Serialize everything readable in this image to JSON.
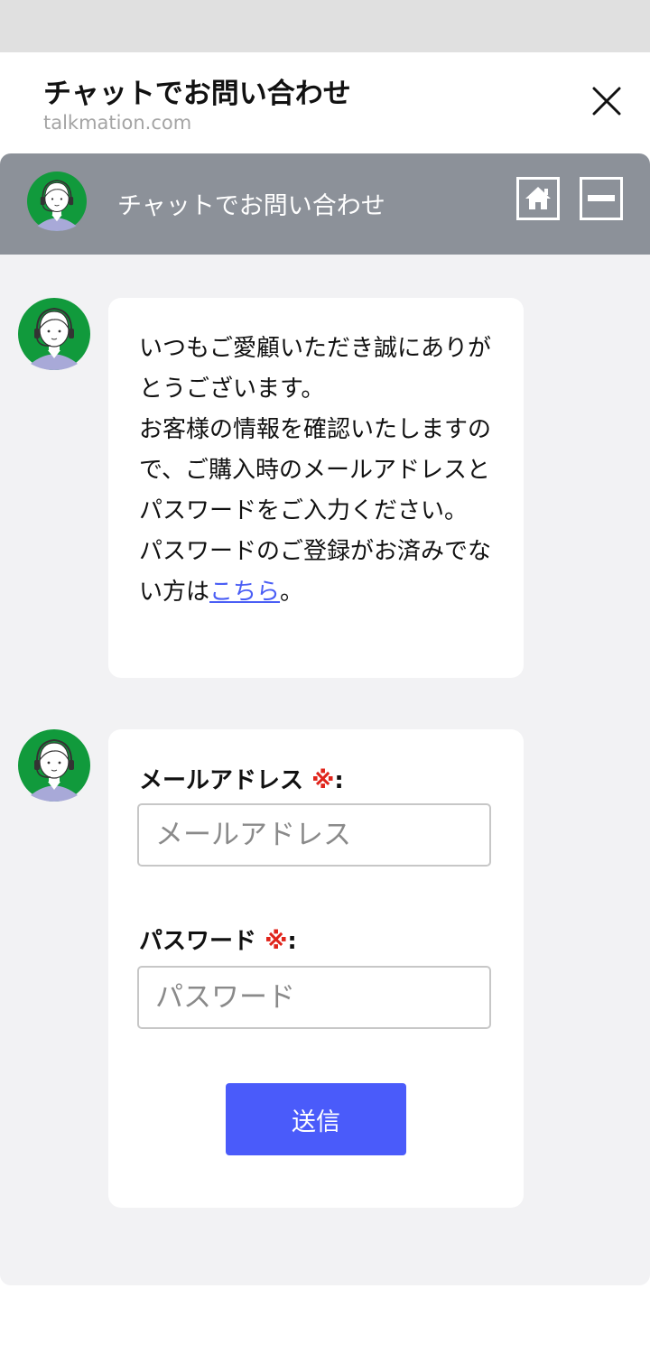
{
  "sheet": {
    "title": "チャットでお問い合わせ",
    "url": "talkmation.com"
  },
  "chat_header": {
    "title": "チャットでお問い合わせ"
  },
  "messages": {
    "welcome": {
      "text_before_link": "いつもご愛顧いただき誠にありがとうございます。\nお客様の情報を確認いたしますので、ご購入時のメールアドレスとパスワードをご入力ください。\nパスワードのご登録がお済みでない方は",
      "link_text": "こちら",
      "text_after_link": "。"
    },
    "form": {
      "email_label": "メールアドレス",
      "email_placeholder": "メールアドレス",
      "password_label": "パスワード",
      "password_placeholder": "パスワード",
      "required_mark": "※",
      "label_suffix": ":",
      "submit_label": "送信"
    }
  },
  "icons": {
    "close": "close-icon",
    "home": "home-icon",
    "minimize": "minimize-icon",
    "avatar": "operator-avatar"
  },
  "colors": {
    "chat_header_bg": "#8c9199",
    "chat_body_bg": "#f2f2f4",
    "submit_bg": "#4a5bfa",
    "required": "#e0241b",
    "link": "#4a5ef5",
    "avatar_bg": "#119a3c"
  }
}
